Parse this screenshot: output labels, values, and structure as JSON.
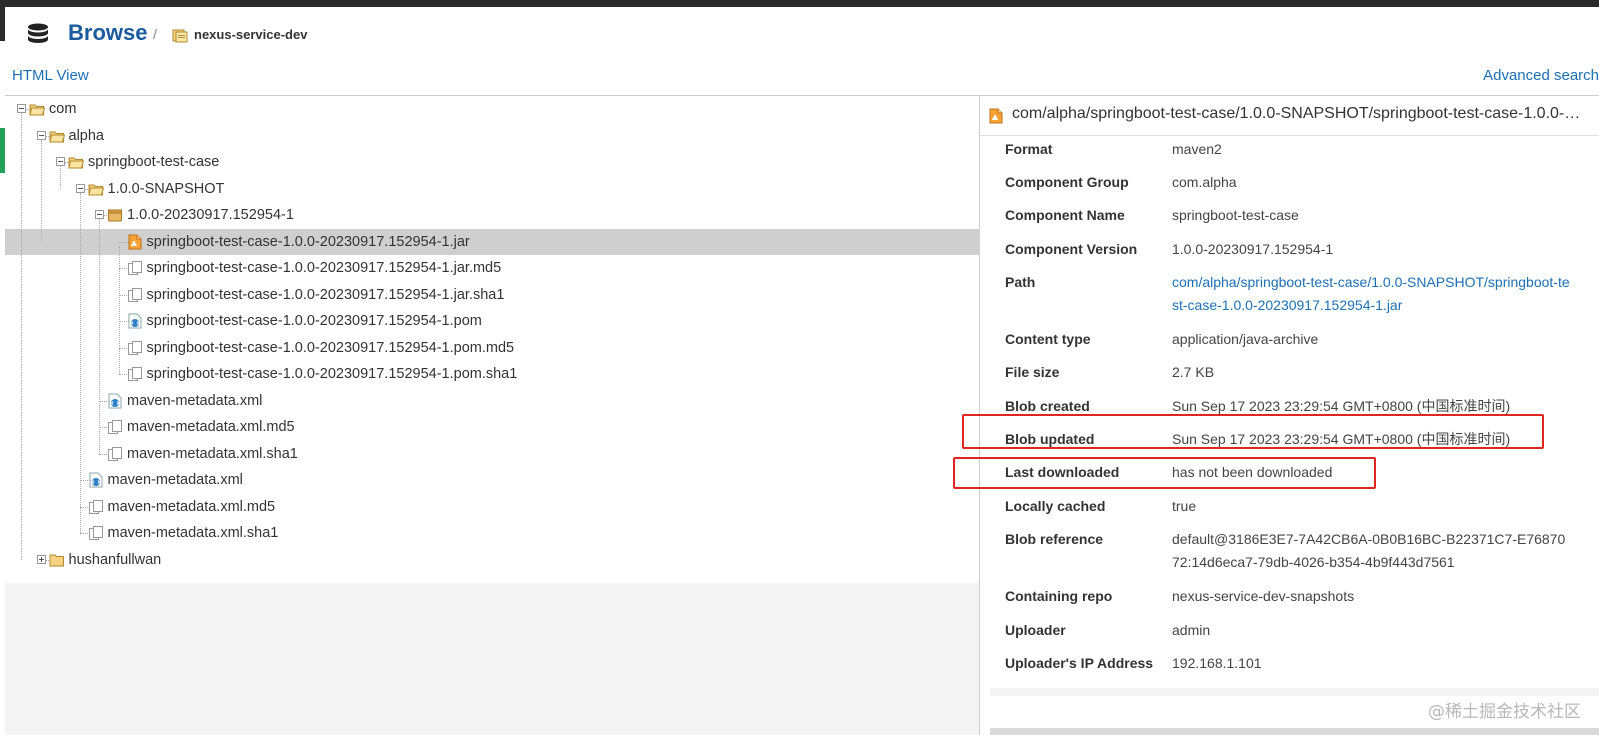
{
  "header": {
    "title": "Browse",
    "separator": "/",
    "repo_name": "nexus-service-dev"
  },
  "toolbar": {
    "html_view": "HTML View",
    "advanced_search": "Advanced search"
  },
  "tree": [
    {
      "label": "com",
      "type": "folder-open",
      "depth": 0,
      "toggle": "minus"
    },
    {
      "label": "alpha",
      "type": "folder-open",
      "depth": 1,
      "toggle": "minus"
    },
    {
      "label": "springboot-test-case",
      "type": "folder-open",
      "depth": 2,
      "toggle": "minus"
    },
    {
      "label": "1.0.0-SNAPSHOT",
      "type": "folder-open",
      "depth": 3,
      "toggle": "minus"
    },
    {
      "label": "1.0.0-20230917.152954-1",
      "type": "component",
      "depth": 4,
      "toggle": "minus"
    },
    {
      "label": "springboot-test-case-1.0.0-20230917.152954-1.jar",
      "type": "jar",
      "depth": 5,
      "selected": true
    },
    {
      "label": "springboot-test-case-1.0.0-20230917.152954-1.jar.md5",
      "type": "file",
      "depth": 5
    },
    {
      "label": "springboot-test-case-1.0.0-20230917.152954-1.jar.sha1",
      "type": "file",
      "depth": 5
    },
    {
      "label": "springboot-test-case-1.0.0-20230917.152954-1.pom",
      "type": "xml",
      "depth": 5
    },
    {
      "label": "springboot-test-case-1.0.0-20230917.152954-1.pom.md5",
      "type": "file",
      "depth": 5
    },
    {
      "label": "springboot-test-case-1.0.0-20230917.152954-1.pom.sha1",
      "type": "file",
      "depth": 5
    },
    {
      "label": "maven-metadata.xml",
      "type": "xml",
      "depth": 4
    },
    {
      "label": "maven-metadata.xml.md5",
      "type": "file",
      "depth": 4
    },
    {
      "label": "maven-metadata.xml.sha1",
      "type": "file",
      "depth": 4
    },
    {
      "label": "maven-metadata.xml",
      "type": "xml",
      "depth": 3
    },
    {
      "label": "maven-metadata.xml.md5",
      "type": "file",
      "depth": 3
    },
    {
      "label": "maven-metadata.xml.sha1",
      "type": "file",
      "depth": 3
    },
    {
      "label": "hushanfullwan",
      "type": "folder-closed",
      "depth": 1,
      "toggle": "plus"
    }
  ],
  "detail": {
    "path": "com/alpha/springboot-test-case/1.0.0-SNAPSHOT/springboot-test-case-1.0.0-20230917.152954-1.jar",
    "rows": [
      {
        "key": "Format",
        "value": "maven2"
      },
      {
        "key": "Component Group",
        "value": "com.alpha"
      },
      {
        "key": "Component Name",
        "value": "springboot-test-case"
      },
      {
        "key": "Component Version",
        "value": "1.0.0-20230917.152954-1"
      },
      {
        "key": "Path",
        "value": "com/alpha/springboot-test-case/1.0.0-SNAPSHOT/springboot-test-case-1.0.0-20230917.152954-1.jar",
        "link": true
      },
      {
        "key": "Content type",
        "value": "application/java-archive"
      },
      {
        "key": "File size",
        "value": "2.7 KB"
      },
      {
        "key": "Blob created",
        "value": "Sun Sep 17 2023 23:29:54 GMT+0800 (中国标准时间)"
      },
      {
        "key": "Blob updated",
        "value": "Sun Sep 17 2023 23:29:54 GMT+0800 (中国标准时间)"
      },
      {
        "key": "Last downloaded",
        "value": "has not been downloaded"
      },
      {
        "key": "Locally cached",
        "value": "true"
      },
      {
        "key": "Blob reference",
        "value": "default@3186E3E7-7A42CB6A-0B0B16BC-B22371C7-E7687072:14d6eca7-79db-4026-b354-4b9f443d7561"
      },
      {
        "key": "Containing repo",
        "value": "nexus-service-dev-snapshots"
      },
      {
        "key": "Uploader",
        "value": "admin"
      },
      {
        "key": "Uploader's IP Address",
        "value": "192.168.1.101"
      }
    ]
  },
  "watermark": "@稀土掘金技术社区",
  "colors": {
    "link": "#1c6fb5",
    "title": "#1c5a9e",
    "selected_row": "#cfcfcf",
    "highlight": "#e0241f",
    "accent_green": "#21a05a"
  }
}
